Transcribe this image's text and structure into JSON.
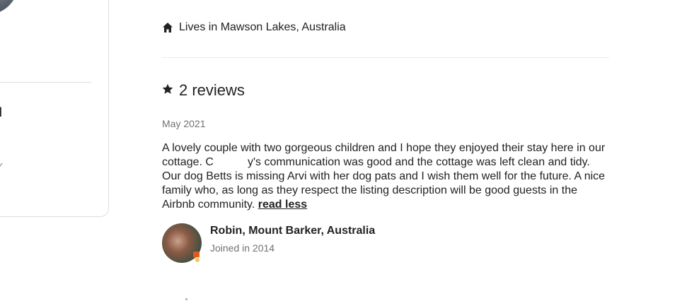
{
  "profile_card": {
    "confirmed_heading": "ned",
    "detail_glyph": "✓"
  },
  "lives": {
    "icon": "home-icon",
    "text": "Lives in Mawson Lakes, Australia"
  },
  "reviews": {
    "icon": "star-icon",
    "title": "2 reviews",
    "items": [
      {
        "date": "May 2021",
        "text_part1": "A lovely couple with two gorgeous children and I hope they enjoyed their stay here in our cottage. C",
        "text_part2": "y's communication was good and the cottage was left clean and tidy. Our dog Betts is missing Arvi with her dog pats and I wish them well for the future. A nice family who, as long as they respect the listing description will be good guests in the Airbnb community.",
        "read_less_label": "read less",
        "reviewer_name": "Robin, Mount Barker, Australia",
        "reviewer_joined": "Joined in 2014"
      }
    ]
  },
  "colors": {
    "text_primary": "#222222",
    "text_secondary": "#717171",
    "divider": "#ebebeb",
    "card_border": "#dddddd"
  }
}
